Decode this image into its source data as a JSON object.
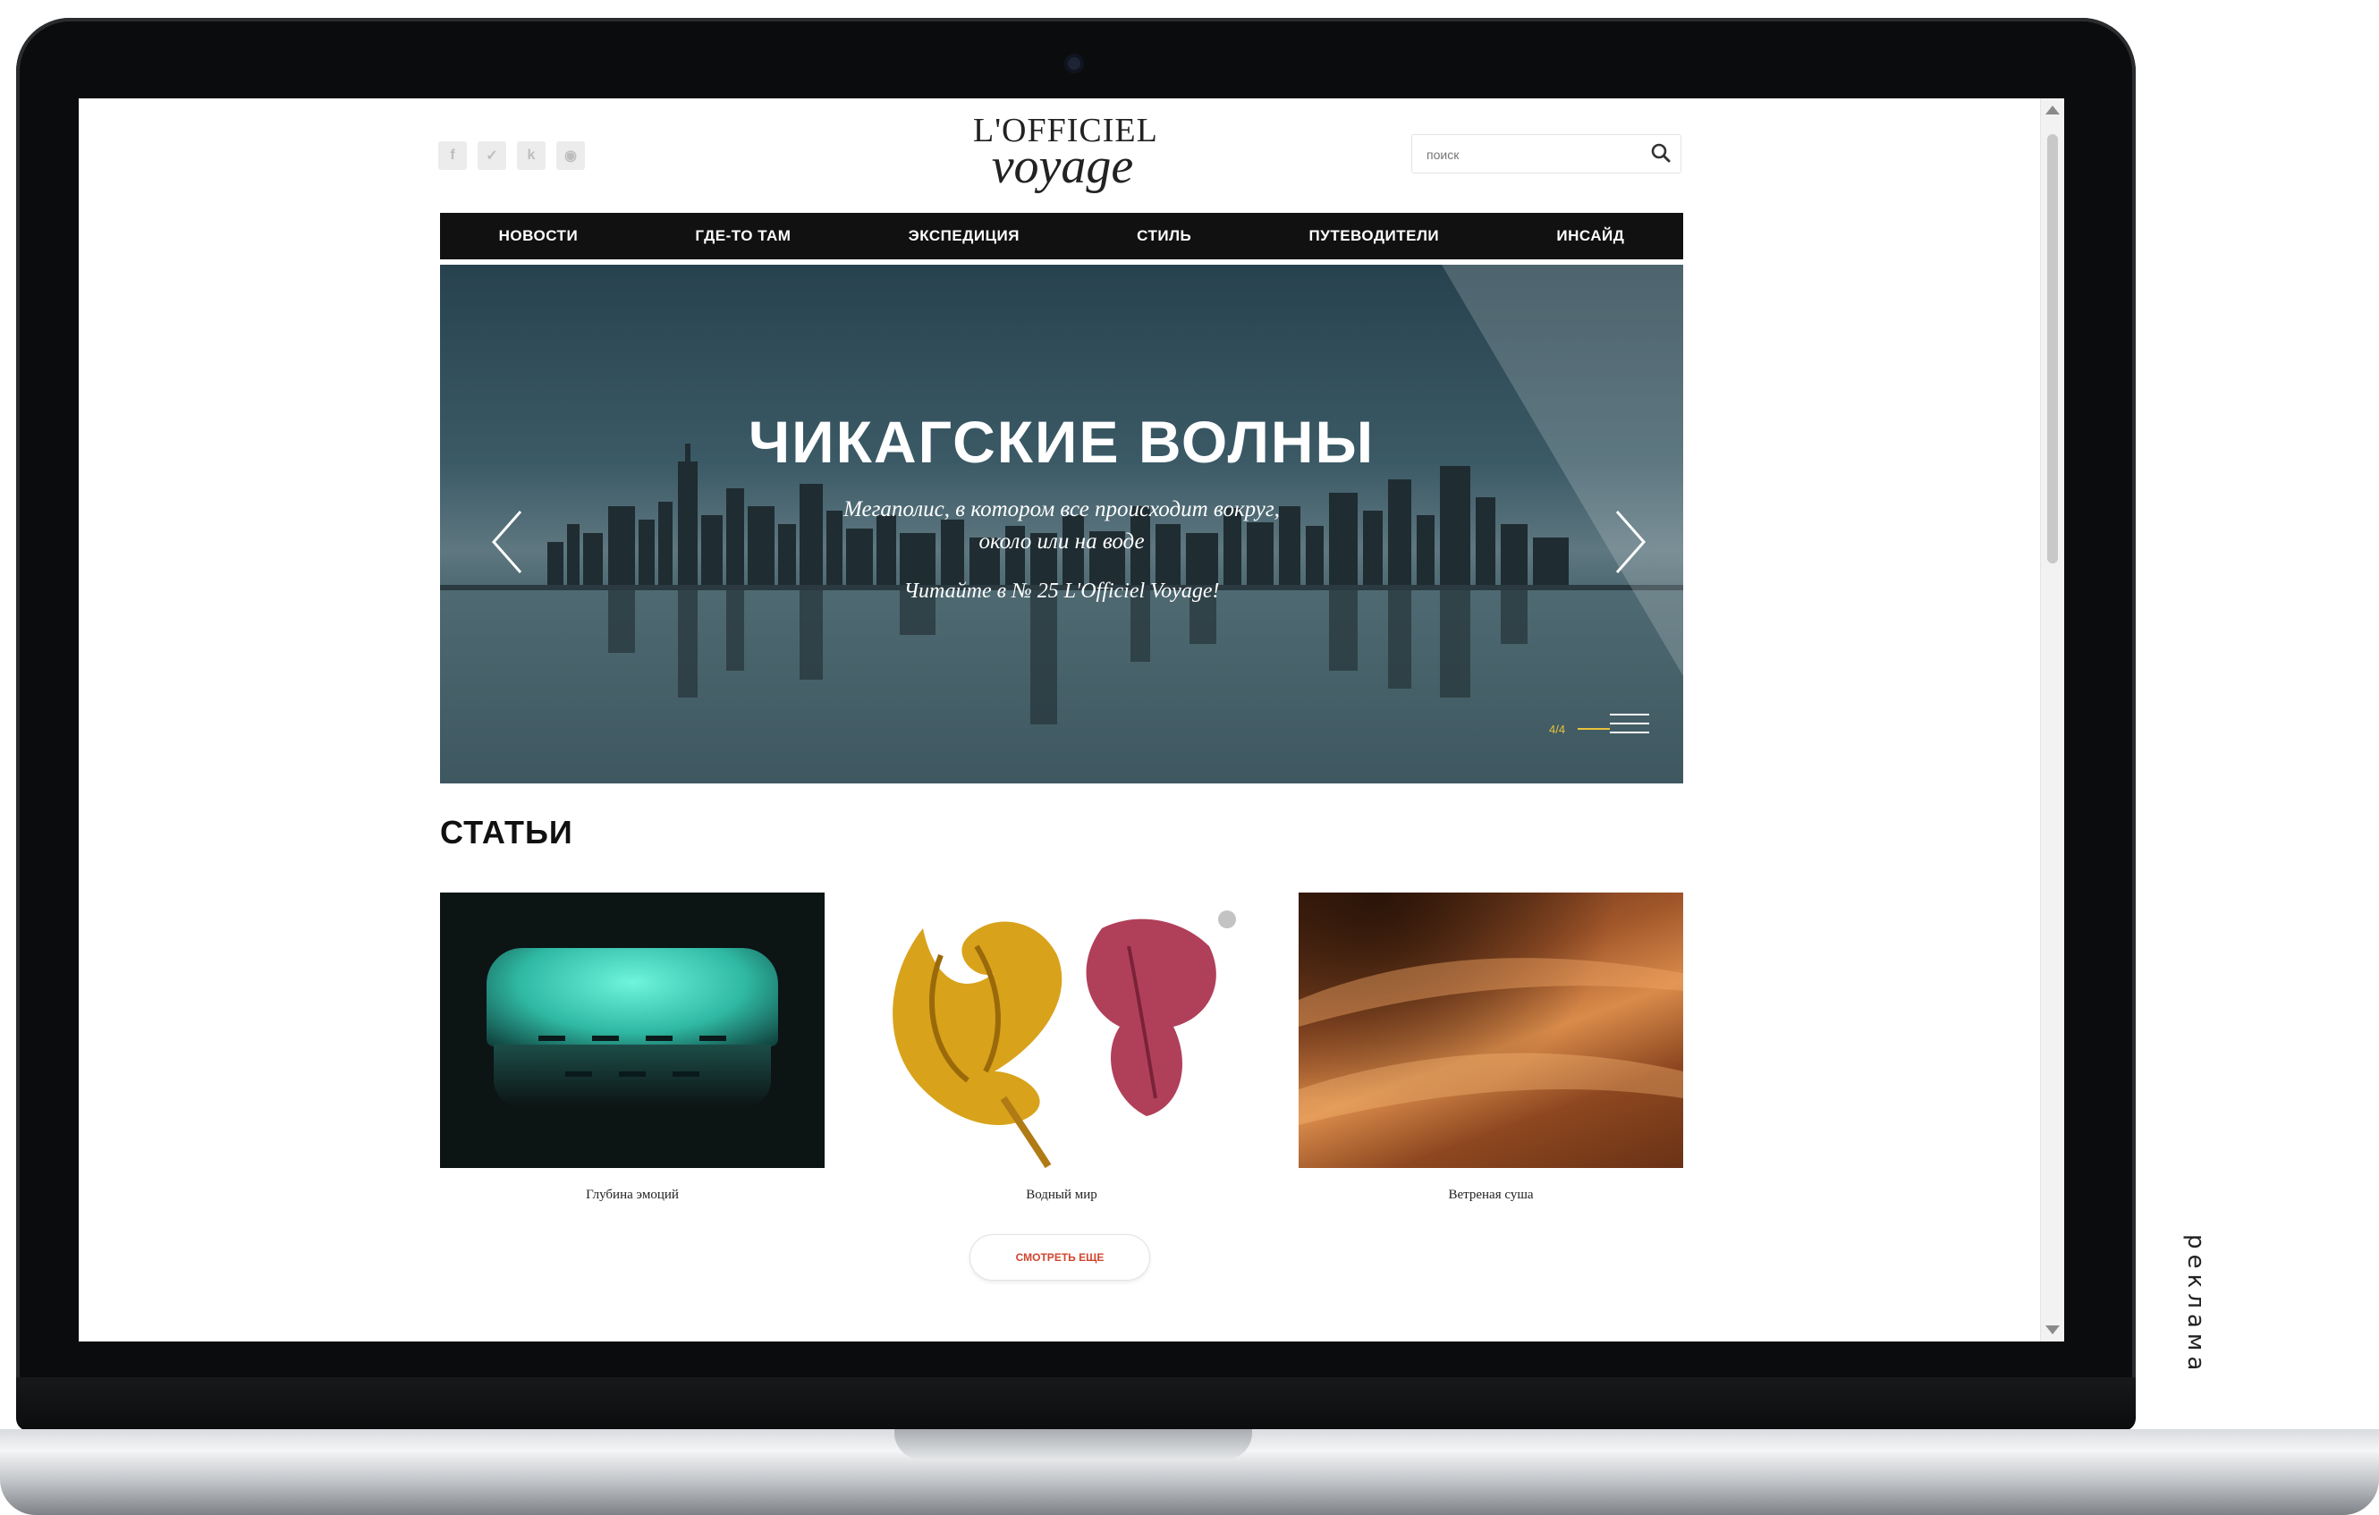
{
  "header": {
    "social": [
      "f",
      "✓",
      "k",
      "◉"
    ],
    "logo_line1": "L'OFFICIEL",
    "logo_line2": "voyage",
    "search_placeholder": "поиск"
  },
  "nav": {
    "items": [
      "НОВОСТИ",
      "ГДЕ-ТО ТАМ",
      "ЭКСПЕДИЦИЯ",
      "СТИЛЬ",
      "ПУТЕВОДИТЕЛИ",
      "ИНСАЙД"
    ]
  },
  "hero": {
    "title": "ЧИКАГСКИЕ ВОЛНЫ",
    "subtitle": "Мегаполис, в котором все происходит вокруг, около или на воде",
    "read_more": "Читайте в № 25 L'Officiel Voyage!",
    "counter": "4/4"
  },
  "articles": {
    "title": "СТАТЬИ",
    "items": [
      {
        "caption": "Глубина эмоций"
      },
      {
        "caption": "Водный мир"
      },
      {
        "caption": "Ветреная суша"
      }
    ],
    "more_label": "СМОТРЕТЬ ЕЩЕ"
  },
  "ad_label": "реклама",
  "colors": {
    "nav_bg": "#111111",
    "accent_yellow": "#e7c23b",
    "more_button_text": "#d2452f"
  },
  "icons": [
    "facebook-icon",
    "vk-icon",
    "odnoklassniki-icon",
    "instagram-icon",
    "search-icon",
    "chevron-left-icon",
    "chevron-right-icon",
    "menu-icon"
  ]
}
